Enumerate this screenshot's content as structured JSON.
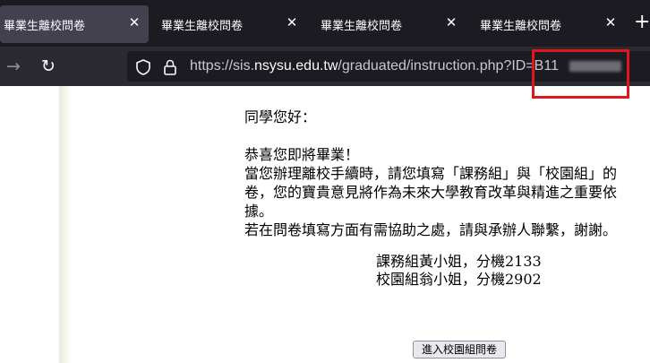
{
  "browser": {
    "tabs": [
      {
        "title": "畢業生離校問卷",
        "active": true
      },
      {
        "title": "畢業生離校問卷",
        "active": false
      },
      {
        "title": "畢業生離校問卷",
        "active": false
      },
      {
        "title": "畢業生離校問卷",
        "active": false
      }
    ],
    "tab_close_glyph": "✕",
    "new_tab_glyph": "+",
    "nav": {
      "forward_glyph": "→",
      "reload_glyph": "↻"
    },
    "url": {
      "scheme": "https://sis.",
      "host": "nsysu.edu.tw",
      "path": "/graduated/instruction.php?ID=B11"
    },
    "icons": [
      "forward-arrow-icon",
      "reload-icon",
      "shield-icon",
      "lock-icon",
      "close-icon",
      "plus-icon"
    ]
  },
  "page": {
    "greeting": "同學您好：",
    "paragraph_lines": [
      "恭喜您即將畢業！",
      "當您辦理離校手續時，請您填寫「課務組」與「校園組」的",
      "卷，您的寶貴意見將作為未來大學教育改革與精進之重要依",
      "據。",
      "若在問卷填寫方面有需協助之處，請與承辦人聯繫，謝謝。"
    ],
    "contacts": [
      "課務組黃小姐，分機2133",
      "校園組翁小姐，分機2902"
    ],
    "button_label": "進入校園組問卷"
  },
  "colors": {
    "tab_strip": "#1c1b22",
    "active_tab": "#42414d",
    "toolbar": "#2b2a33",
    "highlight": "#e0161c"
  }
}
